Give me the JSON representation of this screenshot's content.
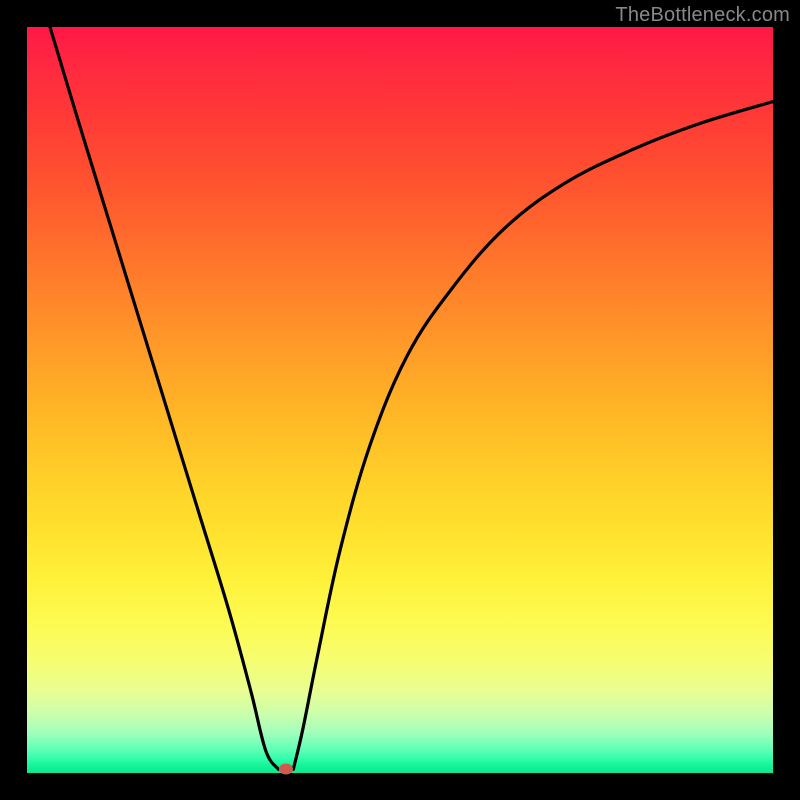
{
  "watermark": "TheBottleneck.com",
  "colors": {
    "frame": "#000000",
    "curve": "#000000",
    "marker": "#d15a4f",
    "gradient_top": "#ff1846",
    "gradient_bottom": "#0de78e"
  },
  "chart_data": {
    "type": "line",
    "title": "",
    "xlabel": "",
    "ylabel": "",
    "xlim": [
      0,
      100
    ],
    "ylim": [
      0,
      100
    ],
    "series": [
      {
        "name": "left-branch",
        "x": [
          3,
          7,
          11,
          15,
          19,
          23,
          27,
          30,
          32,
          33.7
        ],
        "values": [
          100,
          87,
          74,
          61,
          48,
          35,
          22,
          11,
          3,
          0.5
        ]
      },
      {
        "name": "right-branch",
        "x": [
          35.7,
          37,
          39,
          42,
          46,
          51,
          57,
          64,
          72,
          81,
          90,
          100
        ],
        "values": [
          0.5,
          6,
          16,
          30,
          44,
          56,
          65,
          73,
          79,
          83.5,
          87,
          90
        ]
      }
    ],
    "marker": {
      "x": 34.7,
      "y": 0.5
    },
    "background_gradient": {
      "orientation": "vertical",
      "stops": [
        {
          "pos": 0,
          "color": "#ff1846"
        },
        {
          "pos": 50,
          "color": "#ffb726"
        },
        {
          "pos": 80,
          "color": "#fdfb52"
        },
        {
          "pos": 95,
          "color": "#a3ffbb"
        },
        {
          "pos": 100,
          "color": "#0de78e"
        }
      ]
    }
  }
}
